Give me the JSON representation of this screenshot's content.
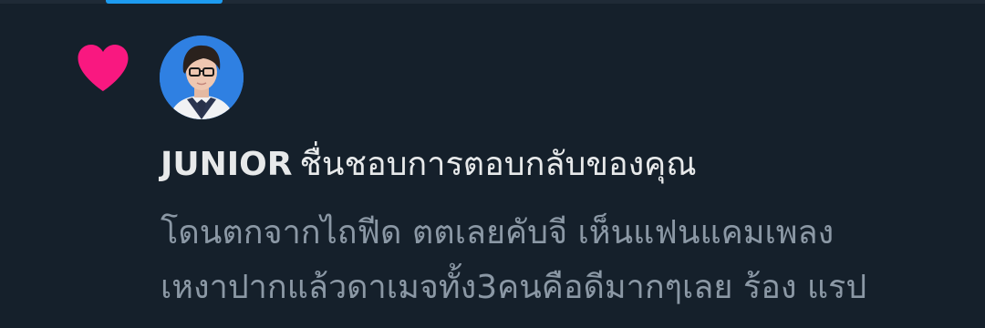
{
  "notification": {
    "type_icon": "heart-icon",
    "type_color": "#f91880",
    "user": {
      "name": "JUNIOR",
      "avatar": "profile-photo"
    },
    "action": "ชื่นชอบการตอบกลับของคุณ",
    "preview_lines": [
      "โดนตกจากไถฟีด ตตเลยคับจี เห็นแฟนแคมเพลง",
      "เหงาปากแล้วดาเมจทั้ง3คนคือดีมากๆเลย ร้อง แรป"
    ]
  },
  "colors": {
    "background": "#15202b",
    "primary_text": "#e7e9ea",
    "secondary_text": "#8b98a5",
    "accent": "#1d9bf0"
  }
}
